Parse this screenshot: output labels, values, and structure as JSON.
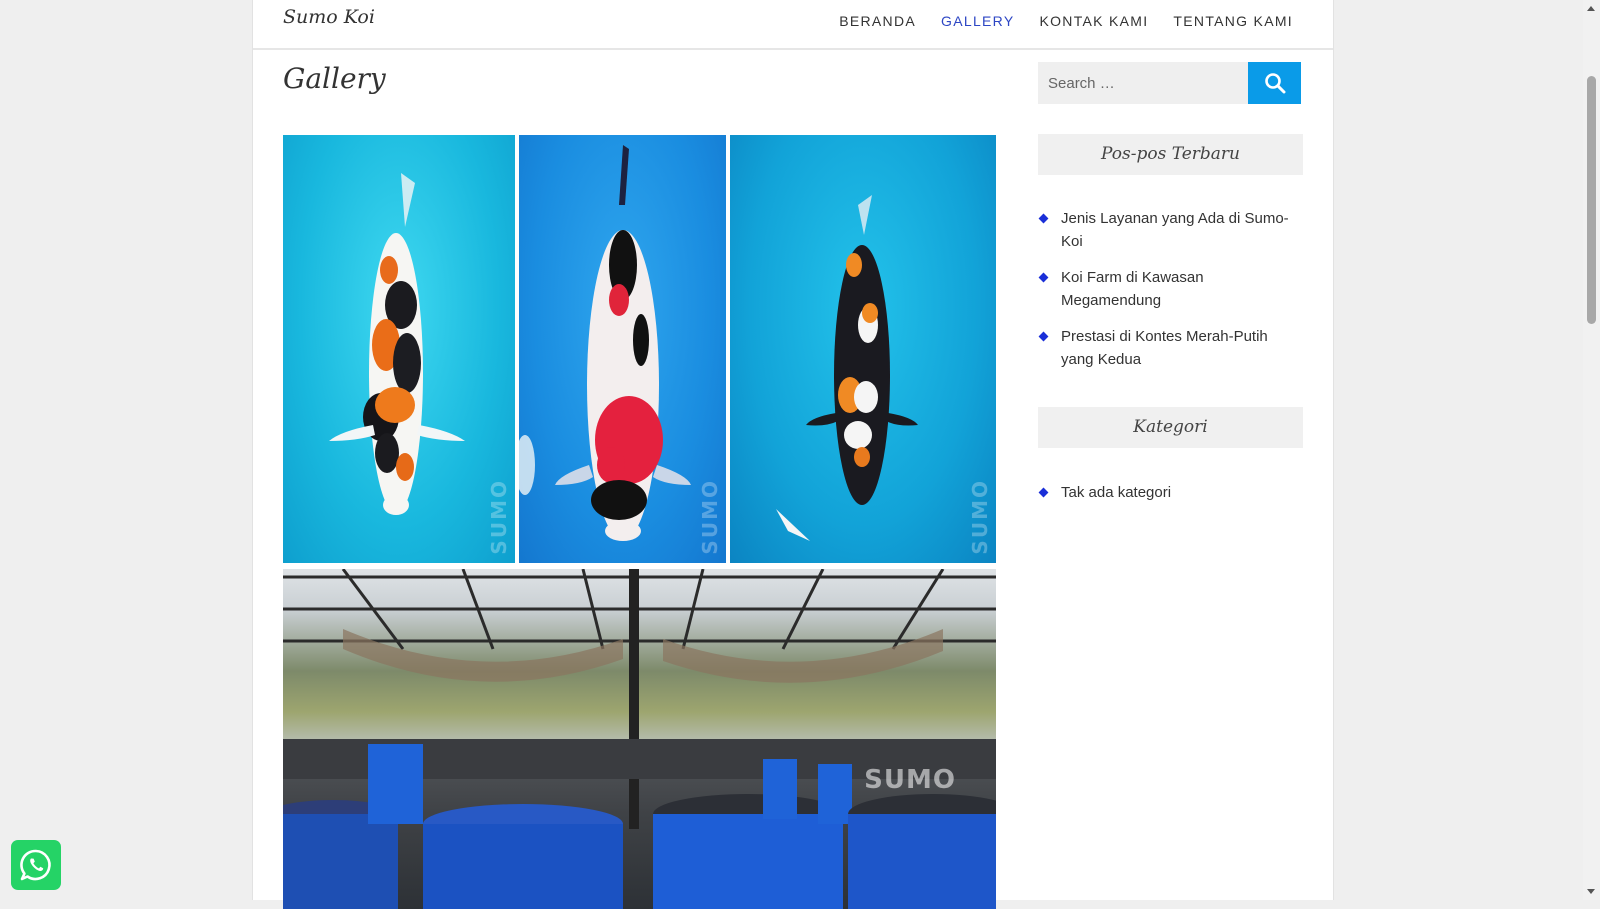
{
  "header": {
    "site_title": "Sumo Koi",
    "nav": [
      {
        "label": "BERANDA",
        "active": false
      },
      {
        "label": "GALLERY",
        "active": true
      },
      {
        "label": "KONTAK KAMI",
        "active": false
      },
      {
        "label": "TENTANG KAMI",
        "active": false
      }
    ]
  },
  "main": {
    "title": "Gallery",
    "gallery": {
      "photos": [
        {
          "subject": "koi-fish-1",
          "watermark": "SUMO"
        },
        {
          "subject": "koi-fish-2",
          "watermark": "SUMO"
        },
        {
          "subject": "koi-fish-3",
          "watermark": "SUMO"
        },
        {
          "subject": "koi-farm-tanks",
          "watermark": "SUMO"
        }
      ]
    }
  },
  "sidebar": {
    "search": {
      "placeholder": "Search …",
      "button_icon": "search-icon"
    },
    "recent_posts": {
      "title": "Pos-pos Terbaru",
      "items": [
        "Jenis Layanan yang Ada di Sumo-Koi",
        "Koi Farm di Kawasan Megamendung",
        "Prestasi di Kontes Merah-Putih yang Kedua"
      ]
    },
    "categories": {
      "title": "Kategori",
      "items": [
        "Tak ada kategori"
      ]
    }
  },
  "floating": {
    "whatsapp_icon": "whatsapp-icon"
  },
  "colors": {
    "accent_nav": "#2d46c4",
    "search_button": "#0a9be8",
    "bullet": "#1a2fd8",
    "whatsapp": "#25d366"
  }
}
